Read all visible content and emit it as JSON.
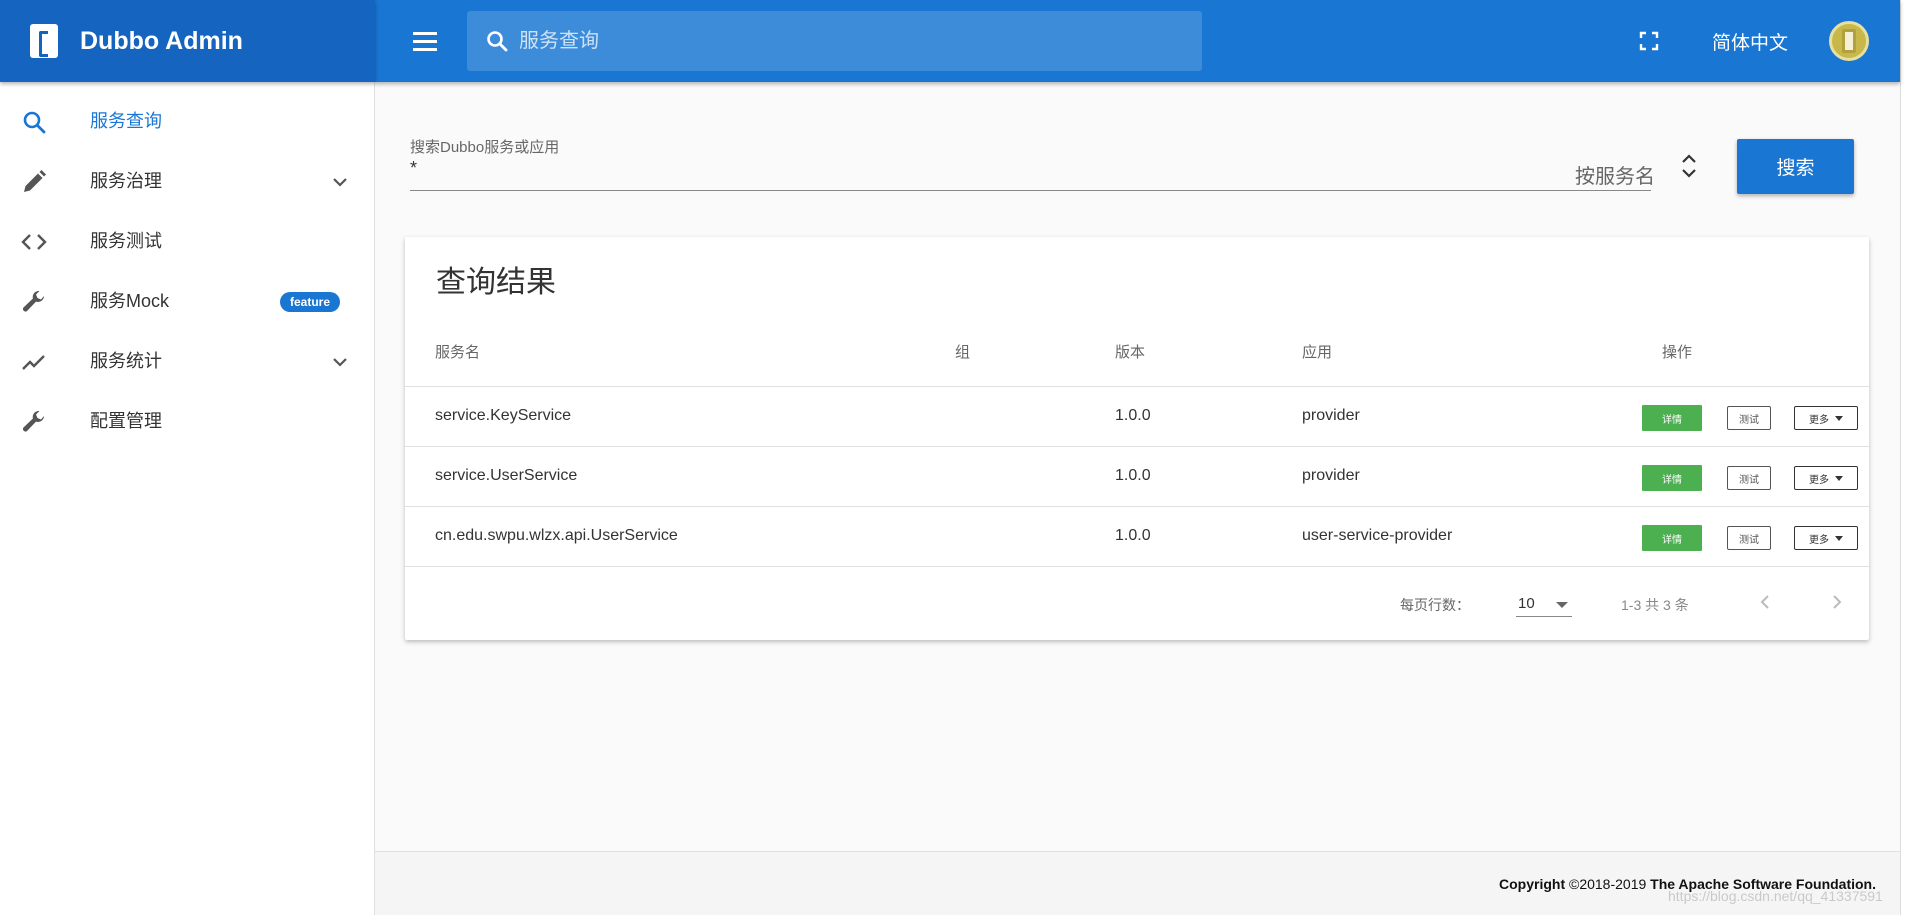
{
  "app": {
    "title": "Dubbo Admin"
  },
  "topbar": {
    "search_placeholder": "服务查询",
    "language": "简体中文"
  },
  "sidebar": {
    "items": [
      {
        "label": "服务查询"
      },
      {
        "label": "服务治理"
      },
      {
        "label": "服务测试"
      },
      {
        "label": "服务Mock",
        "badge": "feature"
      },
      {
        "label": "服务统计"
      },
      {
        "label": "配置管理"
      }
    ]
  },
  "search": {
    "label": "搜索Dubbo服务或应用",
    "value": "*",
    "type": "按服务名",
    "button": "搜索"
  },
  "results": {
    "title": "查询结果",
    "columns": [
      "服务名",
      "组",
      "版本",
      "应用",
      "操作"
    ],
    "rows": [
      {
        "service": "service.KeyService",
        "group": "",
        "version": "1.0.0",
        "app": "provider"
      },
      {
        "service": "service.UserService",
        "group": "",
        "version": "1.0.0",
        "app": "provider"
      },
      {
        "service": "cn.edu.swpu.wlzx.api.UserService",
        "group": "",
        "version": "1.0.0",
        "app": "user-service-provider"
      }
    ],
    "actions": {
      "detail": "详情",
      "test": "测试",
      "more": "更多"
    },
    "rows_per_page_label": "每页行数：",
    "rows_per_page": "10",
    "range": "1-3 共 3 条"
  },
  "footer": {
    "copyright_label": "Copyright",
    "years": "©2018-2019",
    "org": "The Apache Software Foundation."
  },
  "watermark": "https://blog.csdn.net/qq_41337591",
  "colors": {
    "brand_dark": "#1565c0",
    "brand": "#1976d2",
    "detail_green": "#4caf50"
  }
}
